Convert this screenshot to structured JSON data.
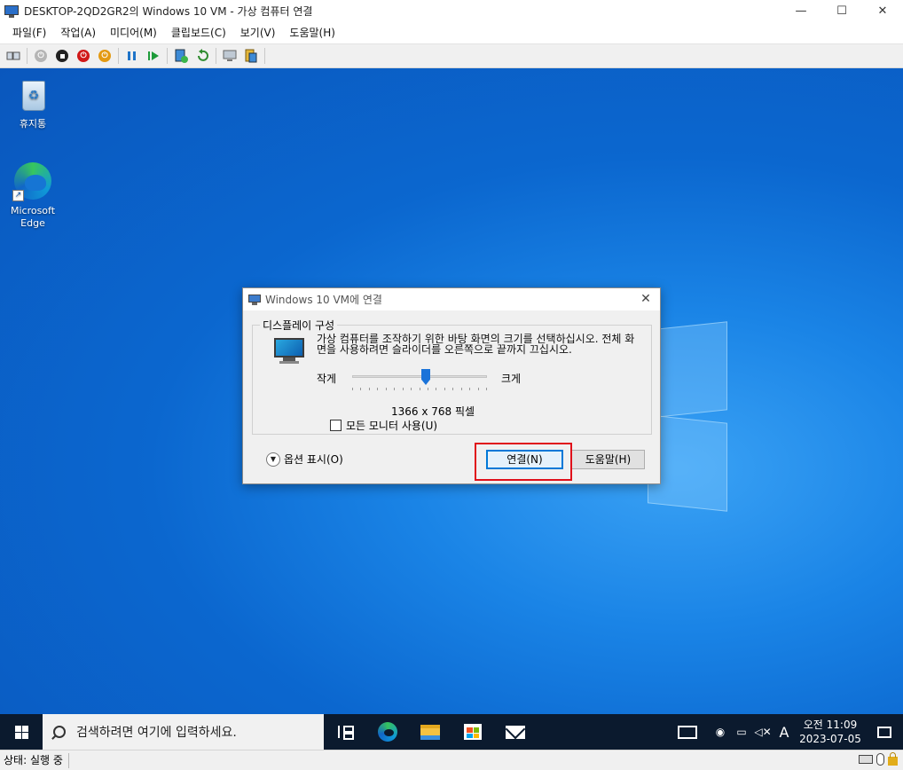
{
  "window": {
    "title": "DESKTOP-2QD2GR2의 Windows 10 VM - 가상 컴퓨터 연결",
    "minimize": "—",
    "maximize": "☐",
    "close": "✕"
  },
  "menu": [
    "파일(F)",
    "작업(A)",
    "미디어(M)",
    "클립보드(C)",
    "보기(V)",
    "도움말(H)"
  ],
  "toolbar": {
    "icons": [
      "ctrl-alt-del-icon",
      "start-icon",
      "turn-off-icon",
      "shut-down-icon",
      "power-icon",
      "pause-icon",
      "resume-icon",
      "checkpoint-icon",
      "revert-icon",
      "enhanced-session-icon",
      "share-icon"
    ]
  },
  "desktop": {
    "recycle_bin_label": "휴지통",
    "edge_label": "Microsoft Edge"
  },
  "dialog": {
    "title": "Windows 10 VM에 연결",
    "group_label": "디스플레이 구성",
    "instruction": "가상 컴퓨터를 조작하기 위한 바탕 화면의 크기를 선택하십시오. 전체 화면을 사용하려면 슬라이더를 오른쪽으로 끝까지 끄십시오.",
    "small_label": "작게",
    "large_label": "크게",
    "slider_fraction": 0.55,
    "resolution": "1366 x 768 픽셀",
    "all_monitors_label": "모든 모니터 사용(U)",
    "all_monitors_checked": false,
    "options_label": "옵션 표시(O)",
    "connect_button": "연결(N)",
    "help_button": "도움말(H)",
    "close": "✕"
  },
  "taskbar": {
    "search_placeholder": "검색하려면 여기에 입력하세요.",
    "ime": "A",
    "clock_time": "오전 11:09",
    "clock_date": "2023-07-05"
  },
  "statusbar": {
    "status": "상태: 실행 중"
  },
  "colors": {
    "highlight": "#e0101a",
    "accent": "#0078d7",
    "taskbar": "#0b1a2e"
  }
}
